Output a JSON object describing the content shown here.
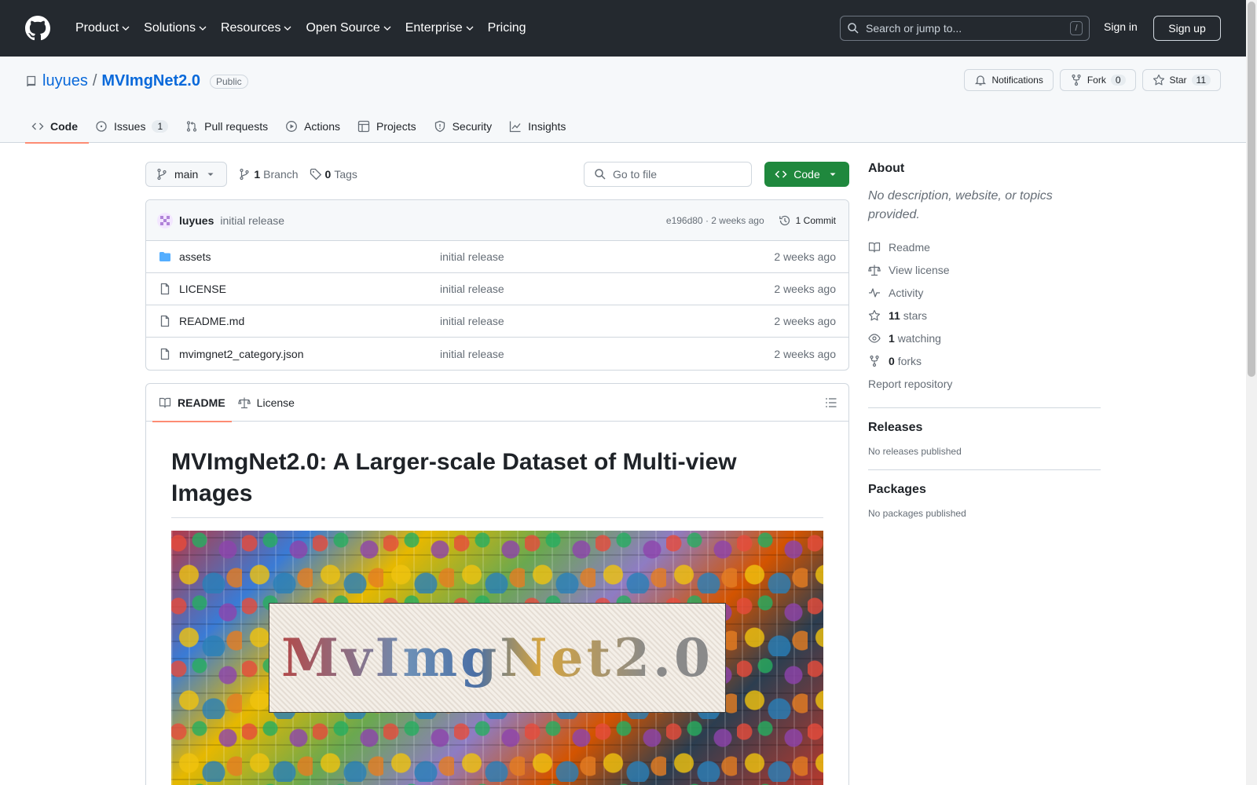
{
  "header": {
    "nav": [
      "Product",
      "Solutions",
      "Resources",
      "Open Source",
      "Enterprise",
      "Pricing"
    ],
    "search_placeholder": "Search or jump to...",
    "search_shortcut": "/",
    "sign_in": "Sign in",
    "sign_up": "Sign up"
  },
  "repo": {
    "owner": "luyues",
    "separator": "/",
    "name": "MVImgNet2.0",
    "visibility": "Public",
    "notifications_label": "Notifications",
    "fork_label": "Fork",
    "fork_count": "0",
    "star_label": "Star",
    "star_count": "11",
    "tabs": [
      {
        "label": "Code"
      },
      {
        "label": "Issues",
        "count": "1"
      },
      {
        "label": "Pull requests"
      },
      {
        "label": "Actions"
      },
      {
        "label": "Projects"
      },
      {
        "label": "Security"
      },
      {
        "label": "Insights"
      }
    ]
  },
  "toolbar": {
    "branch": "main",
    "branches_count": "1",
    "branches_label": "Branch",
    "tags_count": "0",
    "tags_label": "Tags",
    "goto_placeholder": "Go to file",
    "code_label": "Code"
  },
  "commit": {
    "author": "luyues",
    "message": "initial release",
    "hash_time": "e196d80 · 2 weeks ago",
    "commits_label": "1 Commit"
  },
  "files": [
    {
      "name": "assets",
      "type": "folder",
      "message": "initial release",
      "date": "2 weeks ago"
    },
    {
      "name": "LICENSE",
      "type": "file",
      "message": "initial release",
      "date": "2 weeks ago"
    },
    {
      "name": "README.md",
      "type": "file",
      "message": "initial release",
      "date": "2 weeks ago"
    },
    {
      "name": "mvimgnet2_category.json",
      "type": "file",
      "message": "initial release",
      "date": "2 weeks ago"
    }
  ],
  "readme": {
    "tab_readme": "README",
    "tab_license": "License",
    "title": "MVImgNet2.0: A Larger-scale Dataset of Multi-view Images",
    "banner_text": "MvImgNet2.0"
  },
  "about": {
    "heading": "About",
    "description": "No description, website, or topics provided.",
    "readme": "Readme",
    "license": "View license",
    "activity": "Activity",
    "stars_count": "11",
    "stars_label": "stars",
    "watching_count": "1",
    "watching_label": "watching",
    "forks_count": "0",
    "forks_label": "forks",
    "report": "Report repository"
  },
  "releases": {
    "heading": "Releases",
    "empty": "No releases published"
  },
  "packages": {
    "heading": "Packages",
    "empty": "No packages published"
  }
}
